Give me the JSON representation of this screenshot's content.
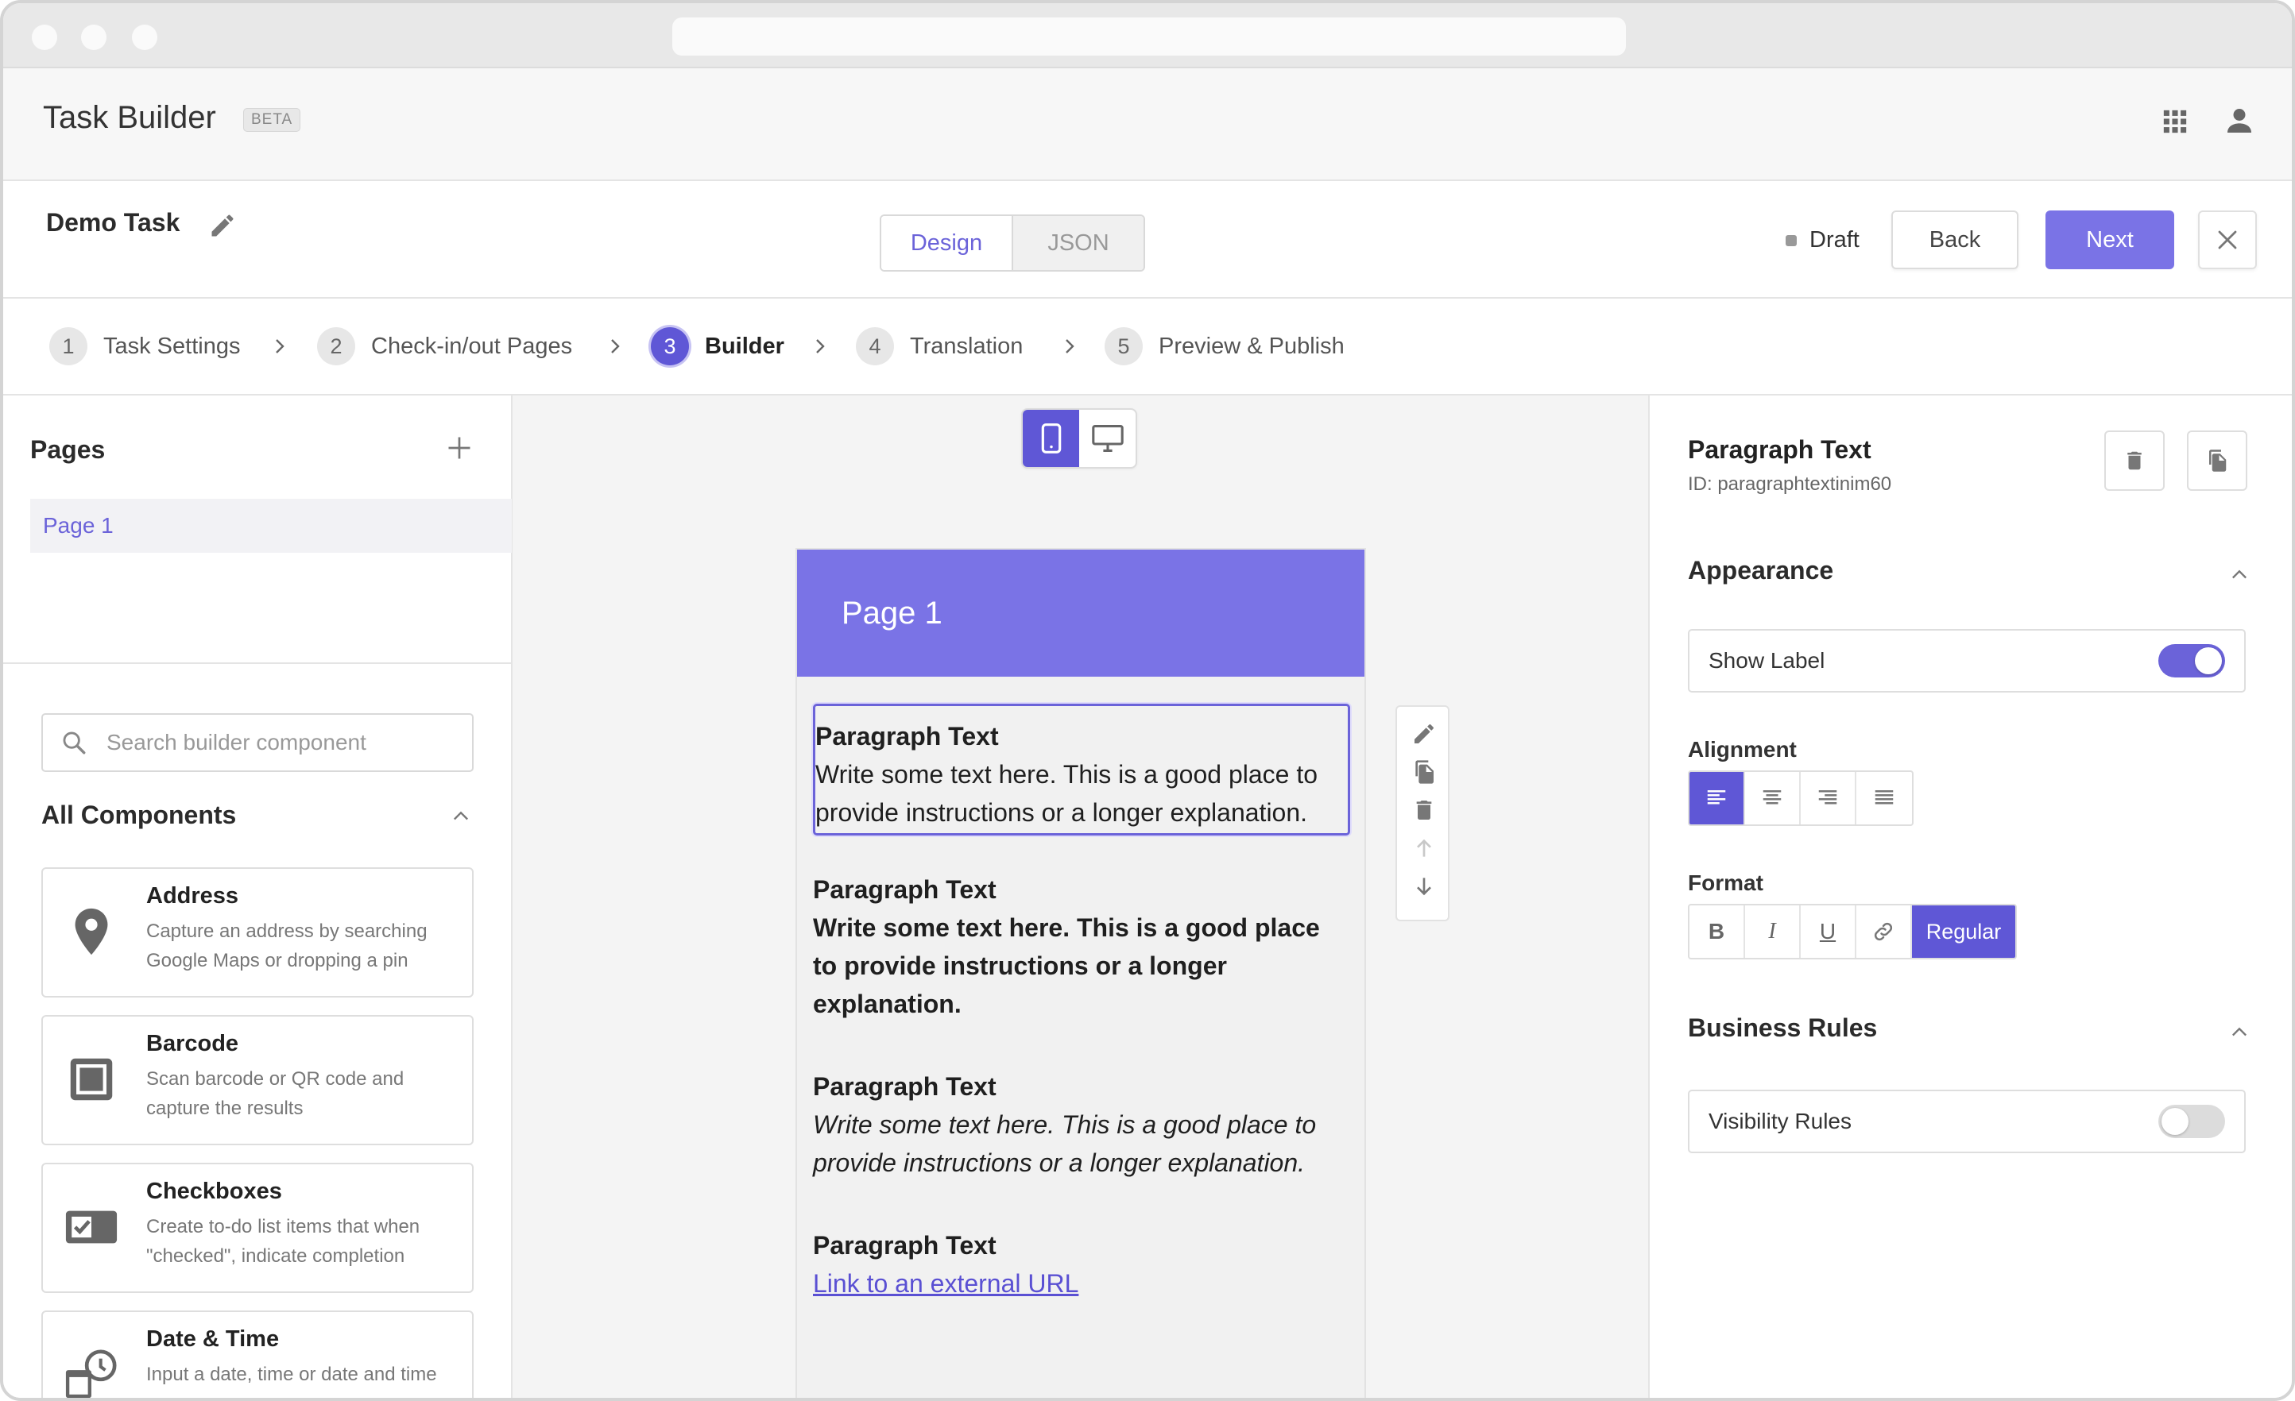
{
  "app": {
    "title": "Task Builder",
    "badge": "BETA"
  },
  "task": {
    "name": "Demo Task",
    "tabs": [
      "Design",
      "JSON"
    ],
    "active_tab": "Design",
    "status": "Draft",
    "back_label": "Back",
    "next_label": "Next"
  },
  "stepper": [
    {
      "num": "1",
      "label": "Task Settings"
    },
    {
      "num": "2",
      "label": "Check-in/out Pages"
    },
    {
      "num": "3",
      "label": "Builder"
    },
    {
      "num": "4",
      "label": "Translation"
    },
    {
      "num": "5",
      "label": "Preview & Publish"
    }
  ],
  "active_step": "3",
  "pages_panel": {
    "title": "Pages",
    "items": [
      "Page 1"
    ]
  },
  "components_panel": {
    "search_placeholder": "Search builder component",
    "section_title": "All Components",
    "items": [
      {
        "name": "Address",
        "desc": "Capture an address by searching Google Maps or dropping a pin",
        "icon": "map-pin-icon"
      },
      {
        "name": "Barcode",
        "desc": "Scan barcode or QR code and capture the results",
        "icon": "barcode-scan-icon"
      },
      {
        "name": "Checkboxes",
        "desc": "Create to-do list items that when \"checked\", indicate completion",
        "icon": "checkbox-icon"
      },
      {
        "name": "Date & Time",
        "desc": "Input a date, time or date and time",
        "icon": "calendar-clock-icon"
      }
    ]
  },
  "canvas": {
    "page_title": "Page 1",
    "paragraphs": [
      {
        "title": "Paragraph Text",
        "body": "Write some text here. This is a good place to provide instructions or a longer explanation.",
        "style": "regular"
      },
      {
        "title": "Paragraph Text",
        "body": "Write some text here. This is a good place to provide instructions or a longer explanation.",
        "style": "bold"
      },
      {
        "title": "Paragraph Text",
        "body": "Write some text here. This is a good place to provide instructions or a longer explanation.",
        "style": "italic"
      },
      {
        "title": "Paragraph Text",
        "body": "Link to an external URL",
        "style": "link"
      }
    ]
  },
  "properties": {
    "title": "Paragraph Text",
    "id_line": "ID: paragraphtextinim60",
    "appearance": {
      "title": "Appearance",
      "show_label": "Show Label",
      "show_label_on": true
    },
    "alignment": {
      "label": "Alignment",
      "active": "left"
    },
    "format": {
      "label": "Format",
      "regular_label": "Regular",
      "bold": "B",
      "italic": "I",
      "underline": "U"
    },
    "business_rules": {
      "title": "Business Rules",
      "visibility_label": "Visibility Rules",
      "visibility_on": false
    }
  },
  "colors": {
    "accent": "#7a73e6",
    "accent_dark": "#5f57d6",
    "link": "#5a50d3"
  }
}
